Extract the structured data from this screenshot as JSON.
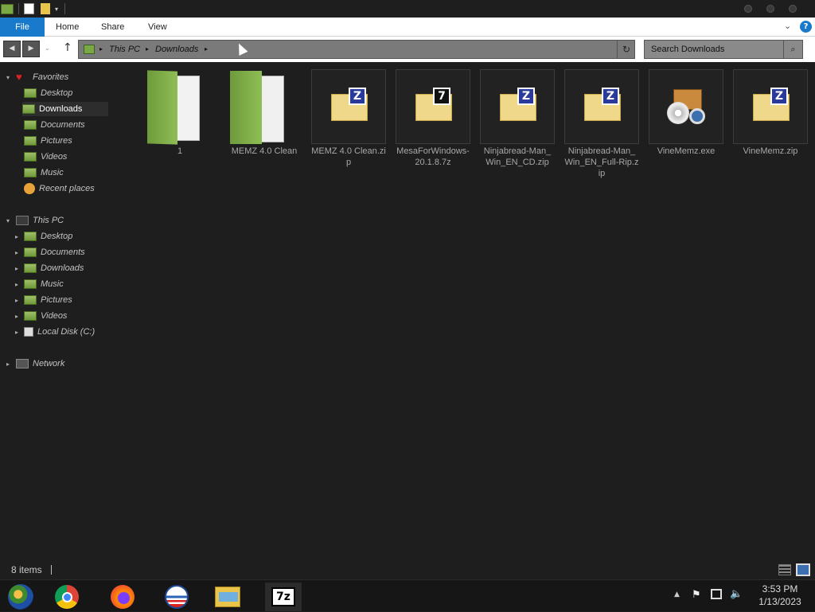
{
  "ribbon": {
    "tabs": [
      "File",
      "Home",
      "Share",
      "View"
    ]
  },
  "address": {
    "segments": [
      "This PC",
      "Downloads"
    ]
  },
  "search": {
    "placeholder": "Search Downloads"
  },
  "nav": {
    "favorites": {
      "label": "Favorites",
      "items": [
        "Desktop",
        "Downloads",
        "Documents",
        "Pictures",
        "Videos",
        "Music",
        "Recent places"
      ]
    },
    "this_pc": {
      "label": "This PC",
      "items": [
        "Desktop",
        "Documents",
        "Downloads",
        "Music",
        "Pictures",
        "Videos",
        "Local Disk (C:)"
      ]
    },
    "network": {
      "label": "Network"
    }
  },
  "files": [
    {
      "name": "1",
      "icon": "folder-icon"
    },
    {
      "name": "MEMZ 4.0 Clean",
      "icon": "folder-icon"
    },
    {
      "name": "MEMZ 4.0 Clean.zip",
      "icon": "zip-archive-icon"
    },
    {
      "name": "MesaForWindows-20.1.8.7z",
      "icon": "7z-archive-icon"
    },
    {
      "name": "Ninjabread-Man_Win_EN_CD.zip",
      "icon": "zip-archive-icon"
    },
    {
      "name": "Ninjabread-Man_Win_EN_Full-Rip.zip",
      "icon": "zip-archive-icon"
    },
    {
      "name": "VineMemz.exe",
      "icon": "installer-icon"
    },
    {
      "name": "VineMemz.zip",
      "icon": "zip-archive-icon"
    }
  ],
  "status": {
    "item_count": "8 items"
  },
  "taskbar": {
    "time": "3:53 PM",
    "date": "1/13/2023",
    "apps": [
      "windows-orb-icon",
      "chrome-icon",
      "firefox-icon",
      "obama-logo-icon",
      "file-explorer-icon",
      "7zip-icon"
    ]
  },
  "colors": {
    "accent": "#1979ca",
    "folder_green": "#7aa845",
    "zip_yellow": "#f0d88a"
  }
}
